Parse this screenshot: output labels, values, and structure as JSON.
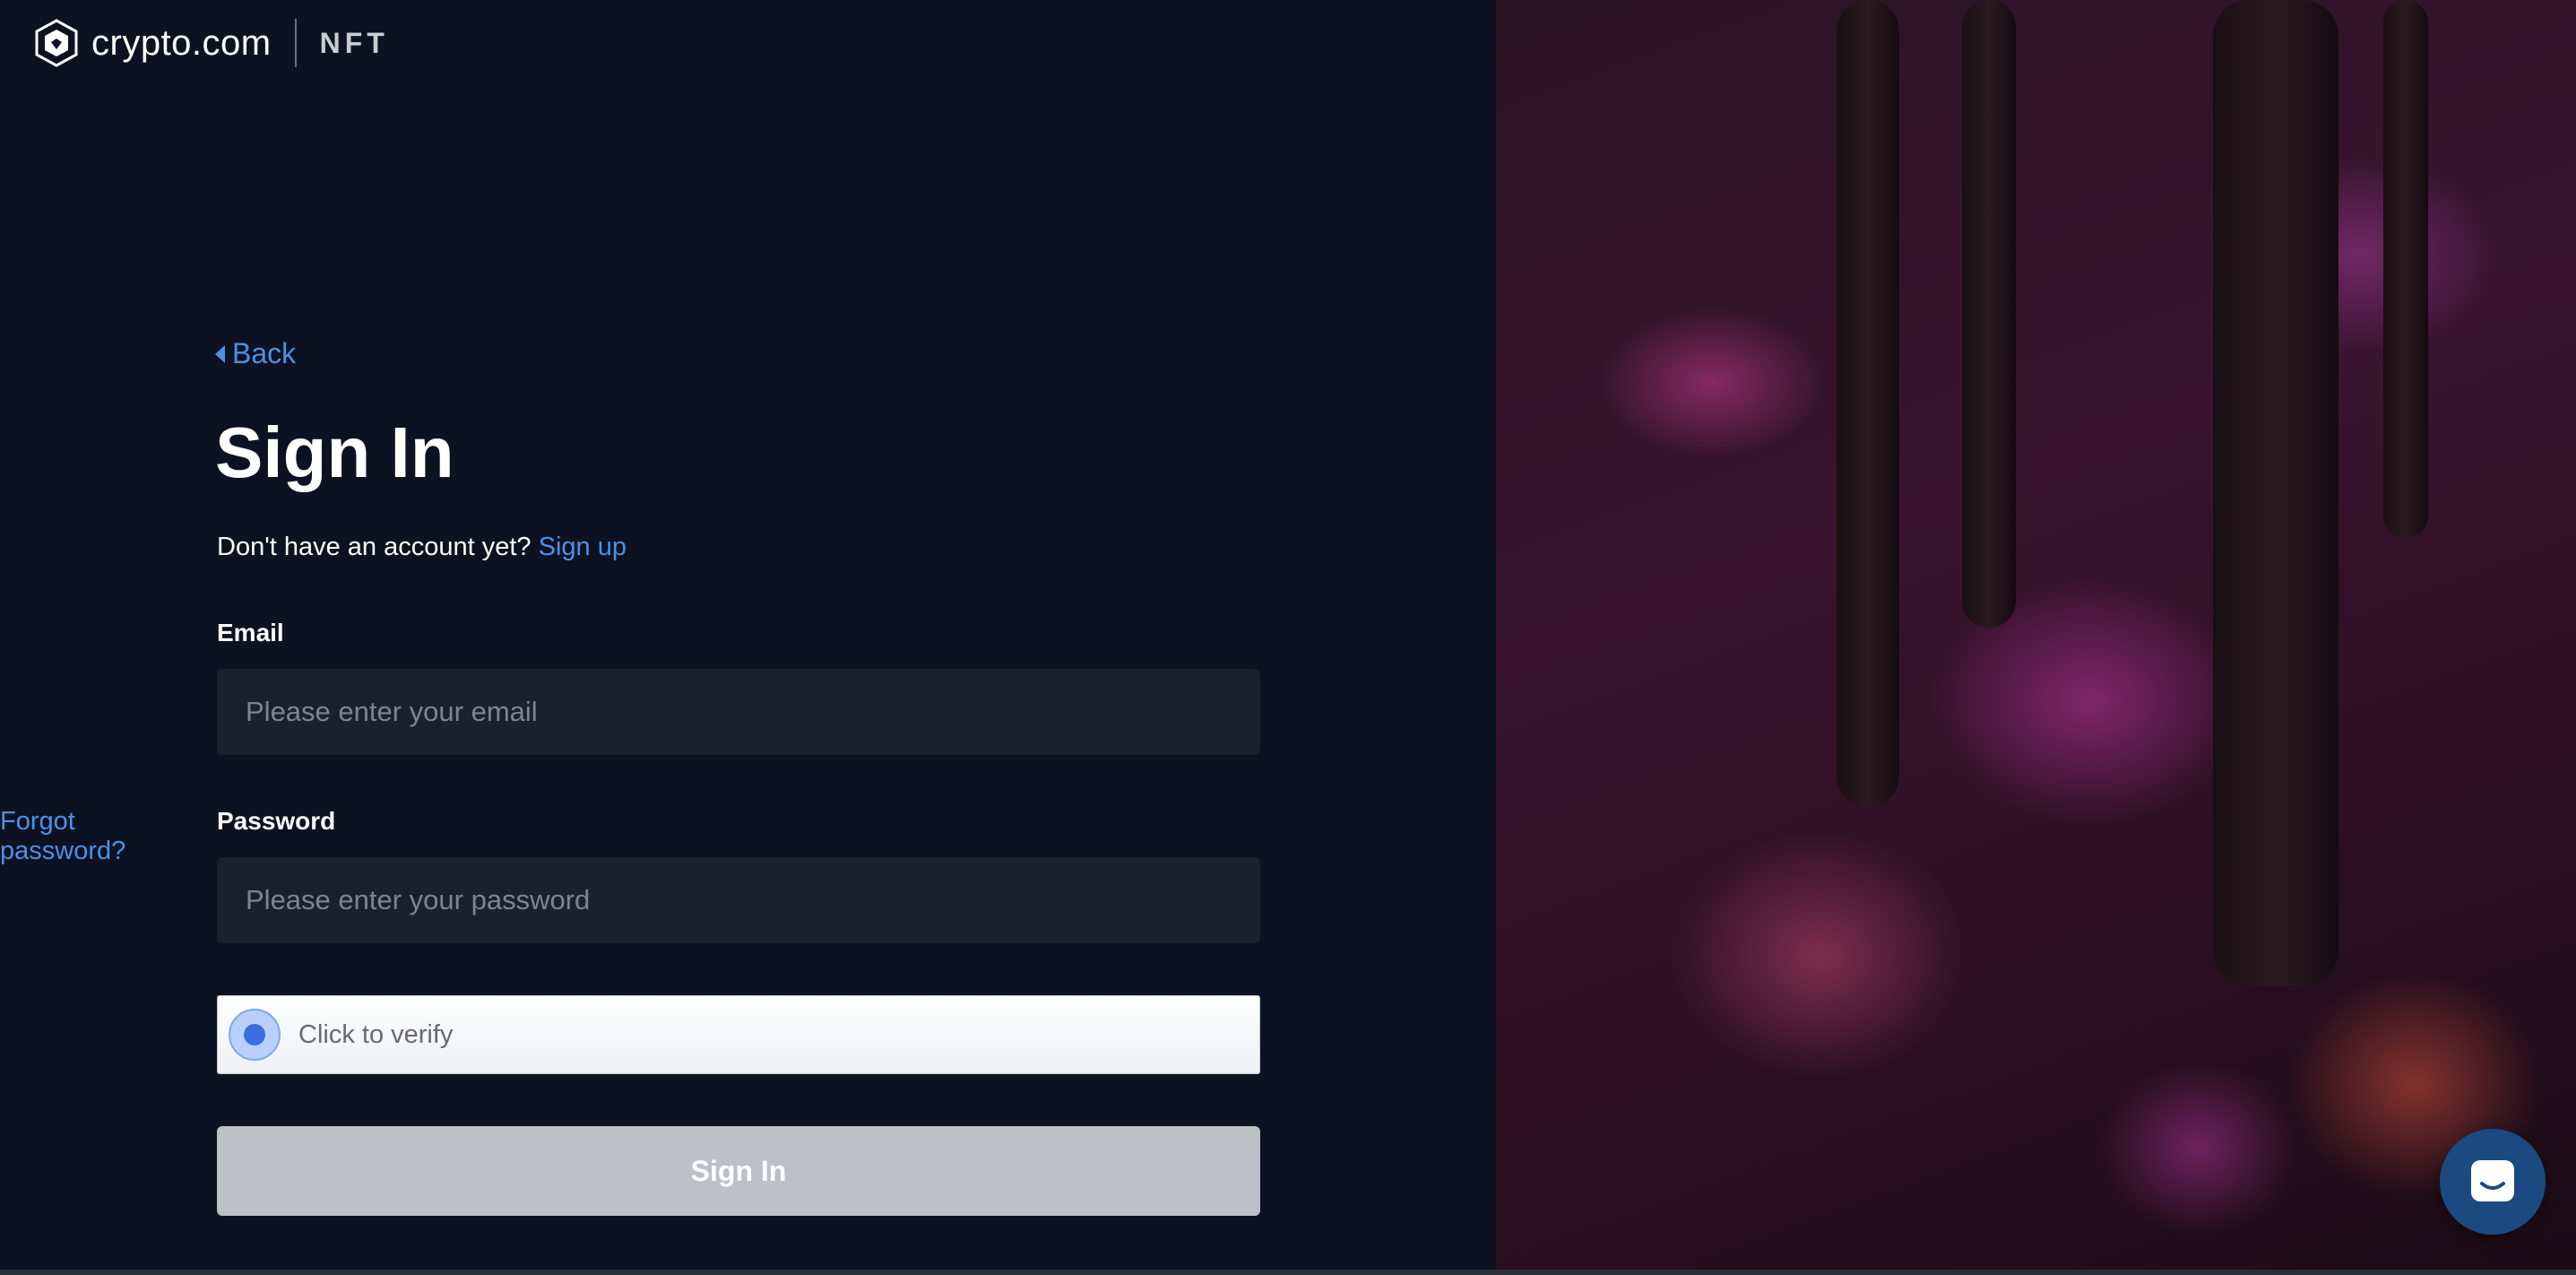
{
  "brand": {
    "logo_text": "crypto.com",
    "product": "NFT"
  },
  "back": {
    "label": "Back"
  },
  "page": {
    "title": "Sign In"
  },
  "signup": {
    "prompt": "Don't have an account yet?",
    "link": "Sign up"
  },
  "form": {
    "email": {
      "label": "Email",
      "placeholder": "Please enter your email",
      "value": ""
    },
    "password": {
      "label": "Password",
      "placeholder": "Please enter your password",
      "value": ""
    },
    "forgot_link": "Forgot password?",
    "captcha_label": "Click to verify",
    "submit_label": "Sign In"
  },
  "colors": {
    "background": "#0d1222",
    "link": "#4d90e6",
    "input_bg": "#1b202d",
    "button_disabled": "#bdc0c6",
    "chat_button": "#1a4a80"
  },
  "icons": {
    "logo": "crypto-com-lion-icon",
    "back": "caret-left-icon",
    "captcha": "verify-radio-icon",
    "chat": "chat-bubble-icon"
  }
}
